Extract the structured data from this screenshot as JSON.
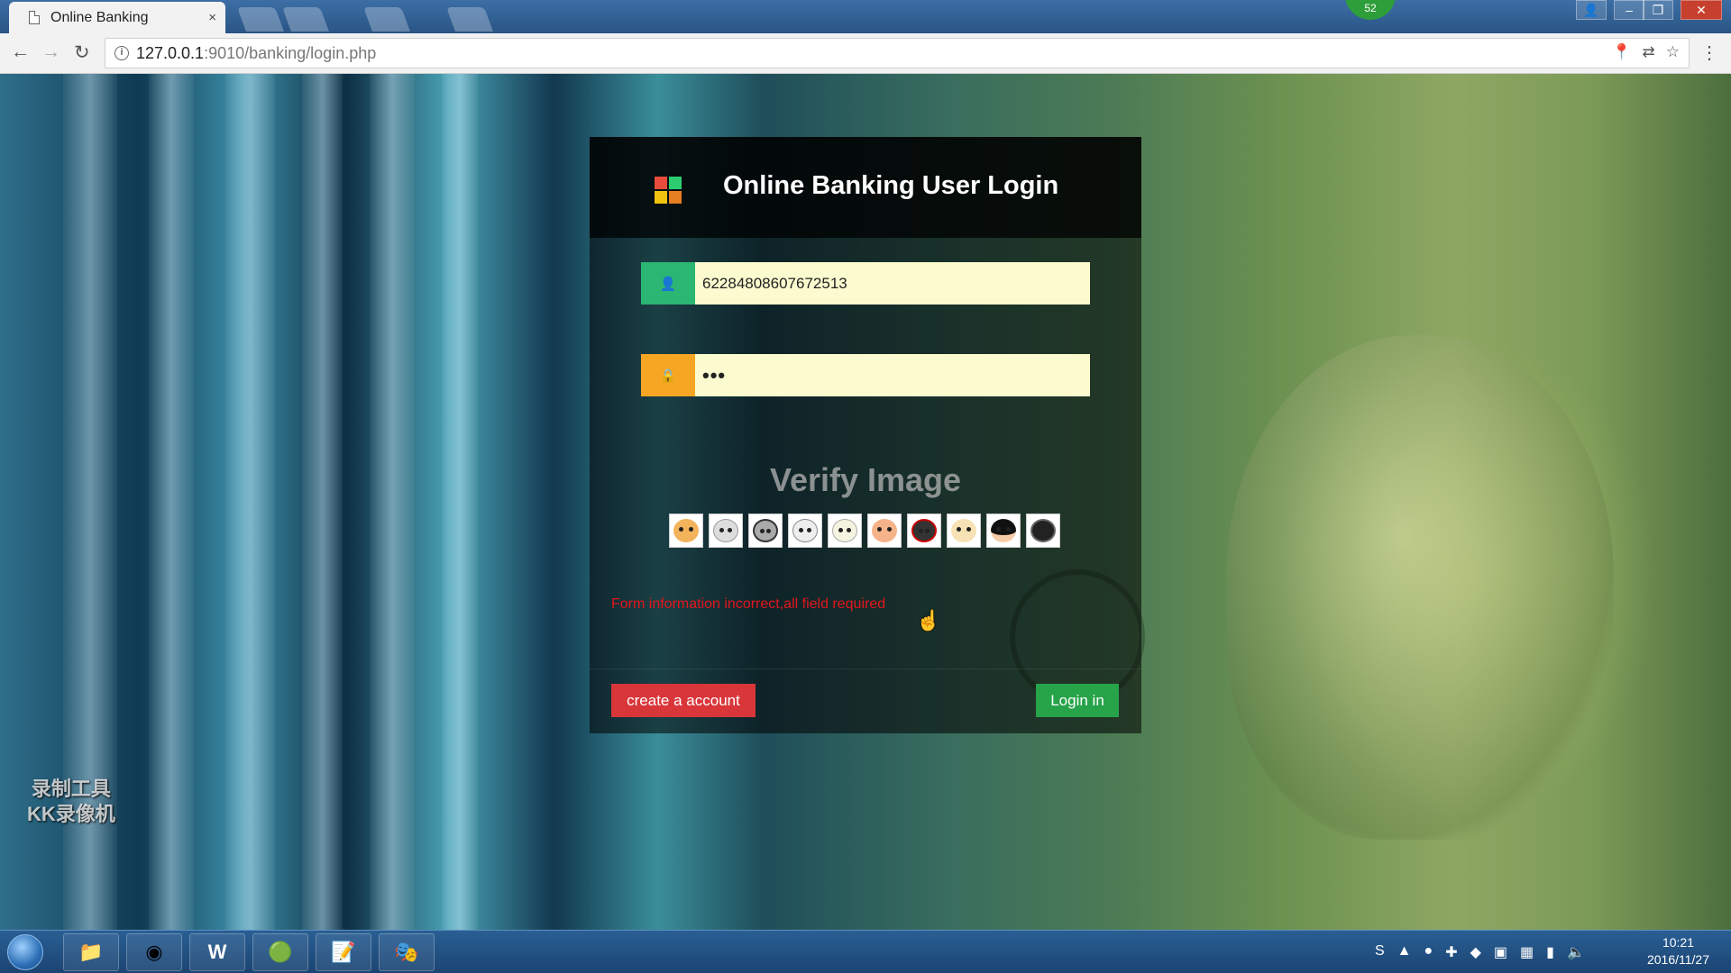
{
  "browser": {
    "tab_title": "Online Banking",
    "tab_close": "×",
    "counter_badge": "52",
    "url_host": "127.0.0.1",
    "url_path": ":9010/banking/login.php"
  },
  "login": {
    "title": "Online Banking User Login",
    "username_value": "62284808607672513",
    "password_value": "•••",
    "verify_title": "Verify Image",
    "verify_images": [
      "cat-1",
      "cat-2",
      "raccoon",
      "rabbits",
      "bear",
      "bird",
      "husky",
      "cat-3",
      "girl",
      "cat-4"
    ],
    "error_message": "Form information incorrect,all field required",
    "create_button": "create a account",
    "login_button": "Login in"
  },
  "watermark": {
    "line1": "录制工具",
    "line2": "KK录像机"
  },
  "taskbar": {
    "time": "10:21",
    "date": "2016/11/27"
  },
  "colors": {
    "user_addon": "#2bb673",
    "pass_addon": "#f6a623",
    "input_bg": "#fbfbcf",
    "error": "#e3161d",
    "create_btn": "#d9363a",
    "login_btn": "#27a34a"
  }
}
